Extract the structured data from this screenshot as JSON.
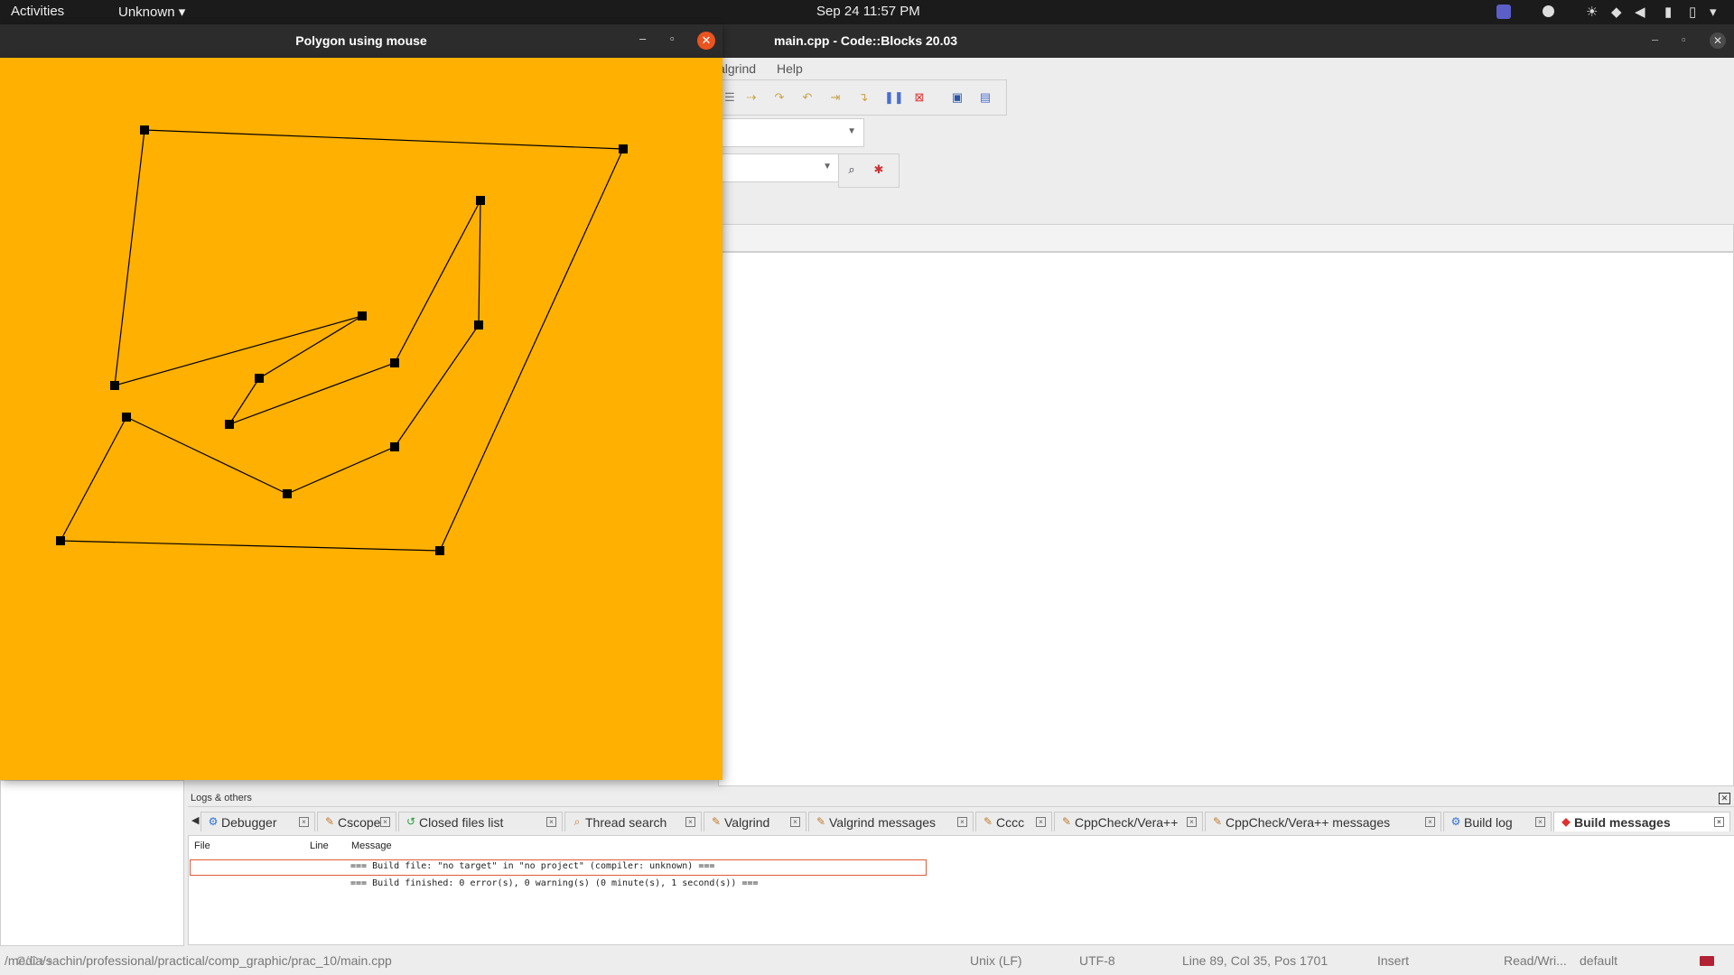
{
  "topbar": {
    "activities": "Activities",
    "app_menu": "Unknown ▾",
    "clock": "Sep 24  11:57 PM"
  },
  "codeblocks": {
    "title": "main.cpp - Code::Blocks 20.03",
    "menu": [
      "algrind",
      "Help"
    ],
    "logs": {
      "title": "Logs & others",
      "tabs": [
        {
          "label": "Debugger",
          "icon": "gear-icon"
        },
        {
          "label": "Cscope",
          "icon": "edit-icon"
        },
        {
          "label": "Closed files list",
          "icon": "undo-icon"
        },
        {
          "label": "Thread search",
          "icon": "search-icon"
        },
        {
          "label": "Valgrind",
          "icon": "edit-icon"
        },
        {
          "label": "Valgrind messages",
          "icon": "edit-icon"
        },
        {
          "label": "Cccc",
          "icon": "edit-icon"
        },
        {
          "label": "CppCheck/Vera++",
          "icon": "edit-icon"
        },
        {
          "label": "CppCheck/Vera++ messages",
          "icon": "edit-icon"
        },
        {
          "label": "Build log",
          "icon": "gear-icon"
        },
        {
          "label": "Build messages",
          "icon": "diamond-icon",
          "active": true
        }
      ],
      "columns": {
        "file": "File",
        "line": "Line",
        "message": "Message"
      },
      "messages": [
        "=== Build file: \"no target\" in \"no project\" (compiler: unknown) ===",
        "=== Build finished: 0 error(s), 0 warning(s) (0 minute(s), 1 second(s)) ==="
      ]
    },
    "statusbar": {
      "path": "/media/sachin/professional/practical/comp_graphic/prac_10/main.cpp",
      "path_overlay": "C/C++",
      "line_ending": "Unix (LF)",
      "encoding": "UTF-8",
      "position": "Line 89, Col 35, Pos 1701",
      "mode": "Insert",
      "access": "Read/Wri...",
      "profile": "default"
    }
  },
  "polygon_window": {
    "title": "Polygon using mouse",
    "canvas_color": "#FFB000",
    "edge_color": "#000000"
  },
  "colors": {
    "topbar_bg": "#1b1b1b",
    "close_button": "#e95420",
    "highlight_border": "#e05a3a"
  }
}
